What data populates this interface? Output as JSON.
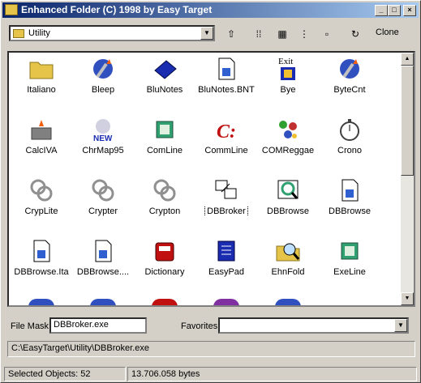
{
  "window": {
    "title": "Enhanced Folder  (C) 1998 by Easy Target"
  },
  "toolbar": {
    "path_value": "Utility",
    "clone_label": "Clone",
    "tools": [
      "up-folder-icon",
      "small-icons-view-icon",
      "list-view-icon",
      "tree-view-icon",
      "sort-icon",
      "refresh-icon"
    ]
  },
  "items": [
    {
      "label": "Italiano",
      "icon": "folder-icon",
      "color": "#e6c449"
    },
    {
      "label": "Bleep",
      "icon": "torch-icon",
      "color": "#3050c0"
    },
    {
      "label": "BluNotes",
      "icon": "notebook-icon",
      "color": "#1a2cb0"
    },
    {
      "label": "BluNotes.BNT",
      "icon": "document-icon",
      "color": "#ffffff"
    },
    {
      "label": "Bye",
      "icon": "exit-icon",
      "color": "#ffffff"
    },
    {
      "label": "ByteCnt",
      "icon": "torch-icon",
      "color": "#3050c0"
    },
    {
      "label": "CalcIVA",
      "icon": "building-icon",
      "color": "#808080"
    },
    {
      "label": "ChrMap95",
      "icon": "charmap-icon",
      "color": "#b04040"
    },
    {
      "label": "ComLine",
      "icon": "setup-icon",
      "color": "#30a070"
    },
    {
      "label": "CommLine",
      "icon": "cmd-icon",
      "color": "#c01010"
    },
    {
      "label": "COMReggae",
      "icon": "molecules-icon",
      "color": "#c03030"
    },
    {
      "label": "Crono",
      "icon": "stopwatch-icon",
      "color": "#c0c0c0"
    },
    {
      "label": "CrypLite",
      "icon": "knot-icon",
      "color": "#c0c0c0"
    },
    {
      "label": "Crypter",
      "icon": "knot-icon",
      "color": "#c0c0c0"
    },
    {
      "label": "Crypton",
      "icon": "knot-icon",
      "color": "#c0c0c0"
    },
    {
      "label": "DBBroker",
      "icon": "database-icon",
      "color": "#ffffff",
      "selected": true
    },
    {
      "label": "DBBrowse",
      "icon": "db-browse-icon",
      "color": "#30a070"
    },
    {
      "label": "DBBrowse",
      "icon": "document-icon",
      "color": "#ffffff"
    },
    {
      "label": "DBBrowse.Ita",
      "icon": "document-icon",
      "color": "#ffffff"
    },
    {
      "label": "DBBrowse....",
      "icon": "document-icon",
      "color": "#ffffff"
    },
    {
      "label": "Dictionary",
      "icon": "dictionary-icon",
      "color": "#c01010"
    },
    {
      "label": "EasyPad",
      "icon": "notepad-icon",
      "color": "#1a2cb0"
    },
    {
      "label": "EhnFold",
      "icon": "magnifier-folder-icon",
      "color": "#e6c449"
    },
    {
      "label": "ExeLine",
      "icon": "setup-icon",
      "color": "#30a070"
    }
  ],
  "bottom": {
    "file_mask_label": "File Mask",
    "file_mask_value": "DBBroker.exe",
    "favorites_label": "Favorites",
    "favorites_value": "",
    "path": "C:\\EasyTarget\\Utility\\DBBroker.exe"
  },
  "status": {
    "selected": "Selected Objects: 52",
    "bytes": "13.706.058 bytes"
  }
}
